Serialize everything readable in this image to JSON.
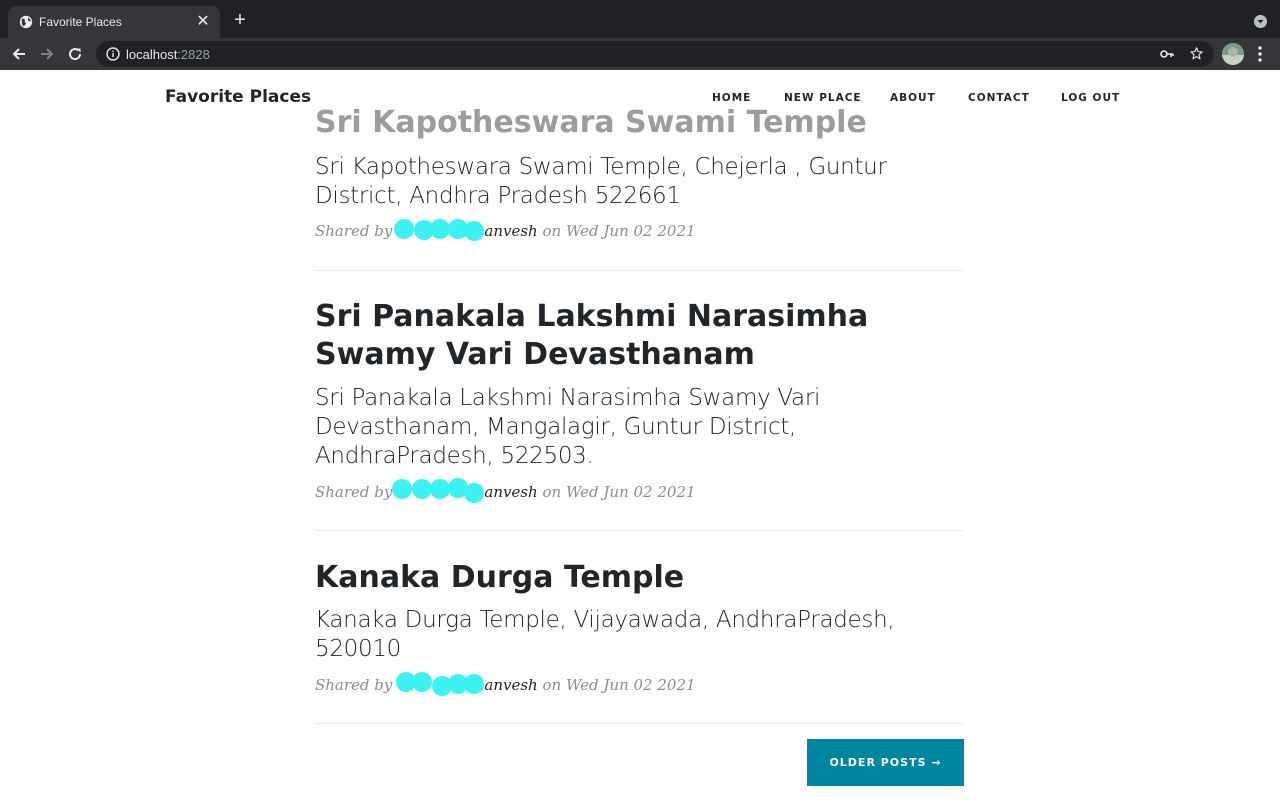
{
  "browser": {
    "tab_title": "Favorite Places",
    "url_host": "localhost",
    "url_port": ":2828"
  },
  "nav": {
    "brand": "Favorite Places",
    "links": [
      "HOME",
      "NEW PLACE",
      "ABOUT",
      "CONTACT",
      "LOG OUT"
    ]
  },
  "posts": [
    {
      "title": "Sri Kapotheswara Swami Temple",
      "subtitle": "Sri Kapotheswara Swami Temple, Chejerla , Guntur District, Andhra Pradesh 522661",
      "shared_by": "Shared by",
      "author_visible": "anvesh",
      "on": "on",
      "date": "Wed Jun 02 2021"
    },
    {
      "title": "Sri Panakala Lakshmi Narasimha Swamy Vari Devasthanam",
      "subtitle": "Sri Panakala Lakshmi Narasimha Swamy Vari Devasthanam, Mangalagir, Guntur District, AndhraPradesh, 522503.",
      "shared_by": "Shared by",
      "author_visible": "anvesh",
      "on": "on",
      "date": "Wed Jun 02 2021"
    },
    {
      "title": "Kanaka Durga Temple",
      "subtitle": "Kanaka Durga Temple, Vijayawada, AndhraPradesh, 520010",
      "shared_by": "Shared by",
      "author_visible": "anvesh",
      "on": "on",
      "date": "Wed Jun 02 2021"
    }
  ],
  "pager": {
    "older_label": "OLDER POSTS →"
  },
  "colors": {
    "accent": "#0085a1",
    "redaction": "#3cf2f0",
    "text": "#212529",
    "meta": "#868e96"
  },
  "icons": [
    "globe-icon",
    "close-icon",
    "plus-icon",
    "back-arrow-icon",
    "forward-arrow-icon",
    "reload-icon",
    "info-icon",
    "key-icon",
    "star-icon",
    "kebab-menu-icon"
  ]
}
